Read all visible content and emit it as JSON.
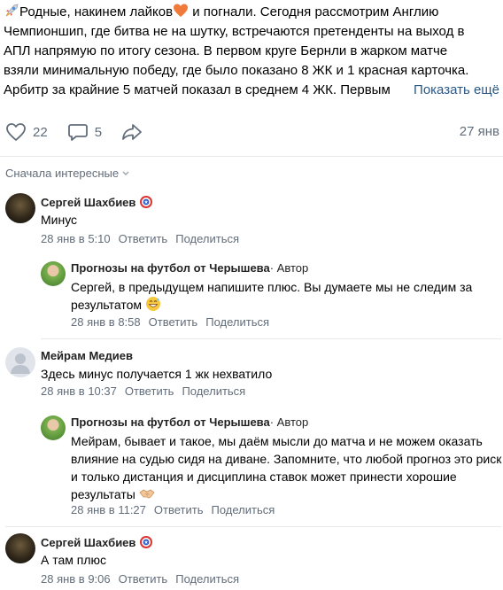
{
  "post": {
    "lines": [
      "Родные, накинем лайков",
      " и погнали. Сегодня рассмотрим Англию",
      "Чемпионшип, где битва не на шутку, встречаются претенденты на выход в",
      "АПЛ напрямую по итогу сезона. В первом круге Бернли в жарком матче",
      "взяли минимальную победу, где было показано 8 ЖК и 1 красная карточка.",
      "Арбитр за крайние 5 матчей показал в среднем 4 ЖК. Первым"
    ],
    "show_more": "Показать ещё",
    "likes": "22",
    "comments": "5",
    "date": "27 янв"
  },
  "sort_label": "Сначала интересные",
  "comments": [
    {
      "author": "Сергей Шахбиев",
      "text": "Минус",
      "date": "28 янв в 5:10",
      "reply": "Ответить",
      "share": "Поделиться"
    },
    {
      "author": "Прогнозы на футбол от Черышева",
      "badge": " · Автор",
      "text": "Сергей, в предыдущем напишите плюс. Вы думаете мы не следим за результатом",
      "date": "28 янв в 8:58",
      "reply": "Ответить",
      "share": "Поделиться"
    },
    {
      "author": "Мейрам Медиев",
      "text": "Здесь минус получается 1 жк нехватило",
      "date": "28 янв в 10:37",
      "reply": "Ответить",
      "share": "Поделиться"
    },
    {
      "author": "Прогнозы на футбол от Черышева",
      "badge": " · Автор",
      "text": "Мейрам, бывает и такое, мы даём мысли до матча и не можем оказать влияние на судью сидя на диване. Запомните, что любой прогноз это риск и только дистанция и дисциплина ставок может принести хорошие результаты",
      "date": "28 янв в 11:27",
      "reply": "Ответить",
      "share": "Поделиться"
    },
    {
      "author": "Сергей Шахбиев",
      "text": "А там плюс",
      "date": "28 янв в 9:06",
      "reply": "Ответить",
      "share": "Поделиться"
    }
  ],
  "colors": {
    "link": "#2a5885",
    "muted": "#626d7a",
    "divider": "#e7e8ec",
    "heart_emoji": "#f07a3a"
  },
  "icons": [
    "rocket-emoji",
    "orange-heart-emoji",
    "heart-icon",
    "comment-icon",
    "share-icon",
    "chevron-down-icon",
    "shield-emoji",
    "grin-sweat-emoji",
    "handshake-emoji"
  ]
}
